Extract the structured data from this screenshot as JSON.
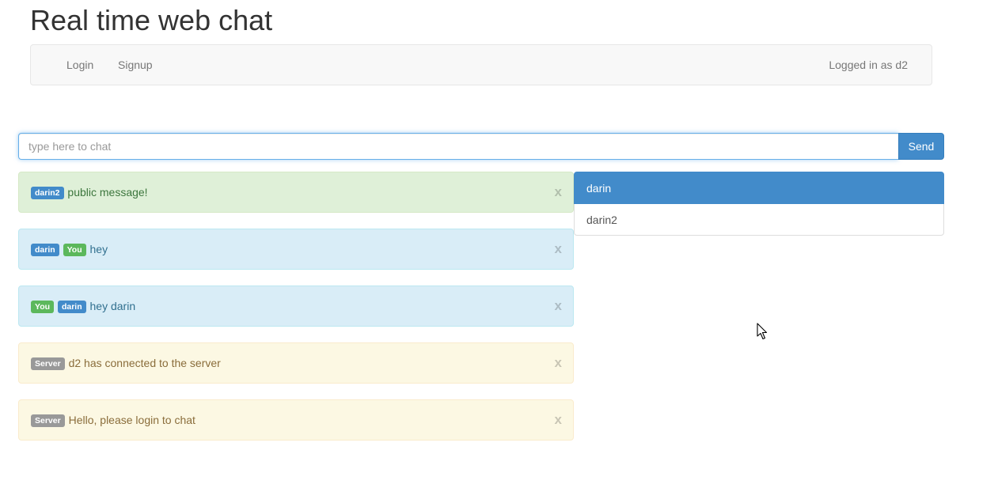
{
  "header": {
    "title": "Real time web chat"
  },
  "navbar": {
    "login_label": "Login",
    "signup_label": "Signup",
    "status_text": "Logged in as d2"
  },
  "chat_form": {
    "placeholder": "type here to chat",
    "value": "",
    "send_label": "Send"
  },
  "messages": [
    {
      "type": "success",
      "labels": [
        {
          "text": "darin2",
          "style": "primary"
        }
      ],
      "text": "public message!",
      "close": "x"
    },
    {
      "type": "info",
      "labels": [
        {
          "text": "darin",
          "style": "primary"
        },
        {
          "text": "You",
          "style": "success"
        }
      ],
      "text": "hey",
      "close": "x"
    },
    {
      "type": "info",
      "labels": [
        {
          "text": "You",
          "style": "success"
        },
        {
          "text": "darin",
          "style": "primary"
        }
      ],
      "text": "hey darin",
      "close": "x"
    },
    {
      "type": "warning",
      "labels": [
        {
          "text": "Server",
          "style": "default"
        }
      ],
      "text": "d2 has connected to the server",
      "close": "x"
    },
    {
      "type": "warning",
      "labels": [
        {
          "text": "Server",
          "style": "default"
        }
      ],
      "text": "Hello, please login to chat",
      "close": "x"
    }
  ],
  "users": [
    {
      "name": "darin",
      "active": true
    },
    {
      "name": "darin2",
      "active": false
    }
  ],
  "colors": {
    "primary": "#428bca",
    "success_label": "#5cb85c",
    "default_label": "#999999",
    "alert_success_bg": "#dff0d8",
    "alert_info_bg": "#d9edf7",
    "alert_warning_bg": "#fcf8e3"
  },
  "icons": {
    "pointer": "mouse-pointer-icon"
  }
}
